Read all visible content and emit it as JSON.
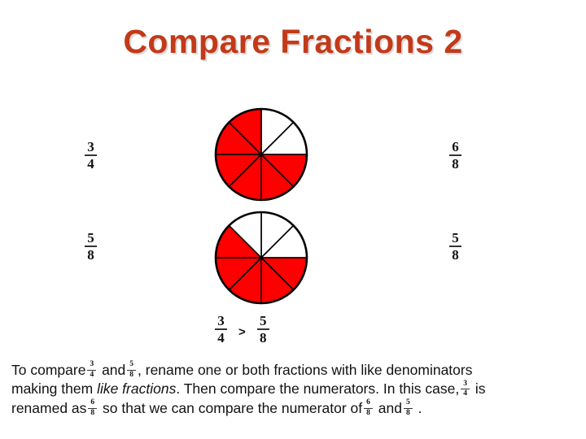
{
  "slide": {
    "title": "Compare Fractions 2",
    "title_color": "#C23A19",
    "background": "#FFFFFF"
  },
  "labels": {
    "top_left": {
      "numerator": "3",
      "denominator": "4"
    },
    "top_right": {
      "numerator": "6",
      "denominator": "8"
    },
    "bottom_left": {
      "numerator": "5",
      "denominator": "8"
    },
    "bottom_right": {
      "numerator": "5",
      "denominator": "8"
    }
  },
  "comparison": {
    "left": {
      "numerator": "3",
      "denominator": "4"
    },
    "operator": ">",
    "right": {
      "numerator": "5",
      "denominator": "8"
    }
  },
  "chart_data": {
    "type": "pie",
    "title": "Compare Fractions 2",
    "shaded_color": "#FF0000",
    "unshaded_color": "#FFFFFF",
    "outline_color": "#000000",
    "charts": [
      {
        "name": "top-circle",
        "label": "3/4 shown as 6/8",
        "slices": 8,
        "shaded": 6,
        "value": 0.75,
        "shaded_indices": [
          2,
          3,
          4,
          5,
          6,
          7
        ],
        "unshaded_indices": [
          0,
          1
        ]
      },
      {
        "name": "bottom-circle",
        "label": "5/8",
        "slices": 8,
        "shaded": 5,
        "value": 0.625,
        "shaded_indices": [
          2,
          3,
          4,
          5,
          6
        ],
        "unshaded_indices": [
          0,
          1,
          7
        ]
      }
    ]
  },
  "body": {
    "line1_a": "To compare",
    "line1_frac1": {
      "numerator": "3",
      "denominator": "4"
    },
    "line1_b": "and",
    "line1_frac2": {
      "numerator": "5",
      "denominator": "8"
    },
    "line1_c": ", rename one or both fractions with like denominators",
    "line2_a": "making them",
    "line2_em": "like fractions",
    "line2_b": ". Then compare the numerators. In this case,",
    "line2_frac1": {
      "numerator": "3",
      "denominator": "4"
    },
    "line2_c": "is",
    "line3_a": "renamed as",
    "line3_frac1": {
      "numerator": "6",
      "denominator": "8"
    },
    "line3_b": "so that we can compare the numerator of",
    "line3_frac2": {
      "numerator": "6",
      "denominator": "8"
    },
    "line3_c": "and",
    "line3_frac3": {
      "numerator": "5",
      "denominator": "8"
    },
    "line3_d": "."
  }
}
